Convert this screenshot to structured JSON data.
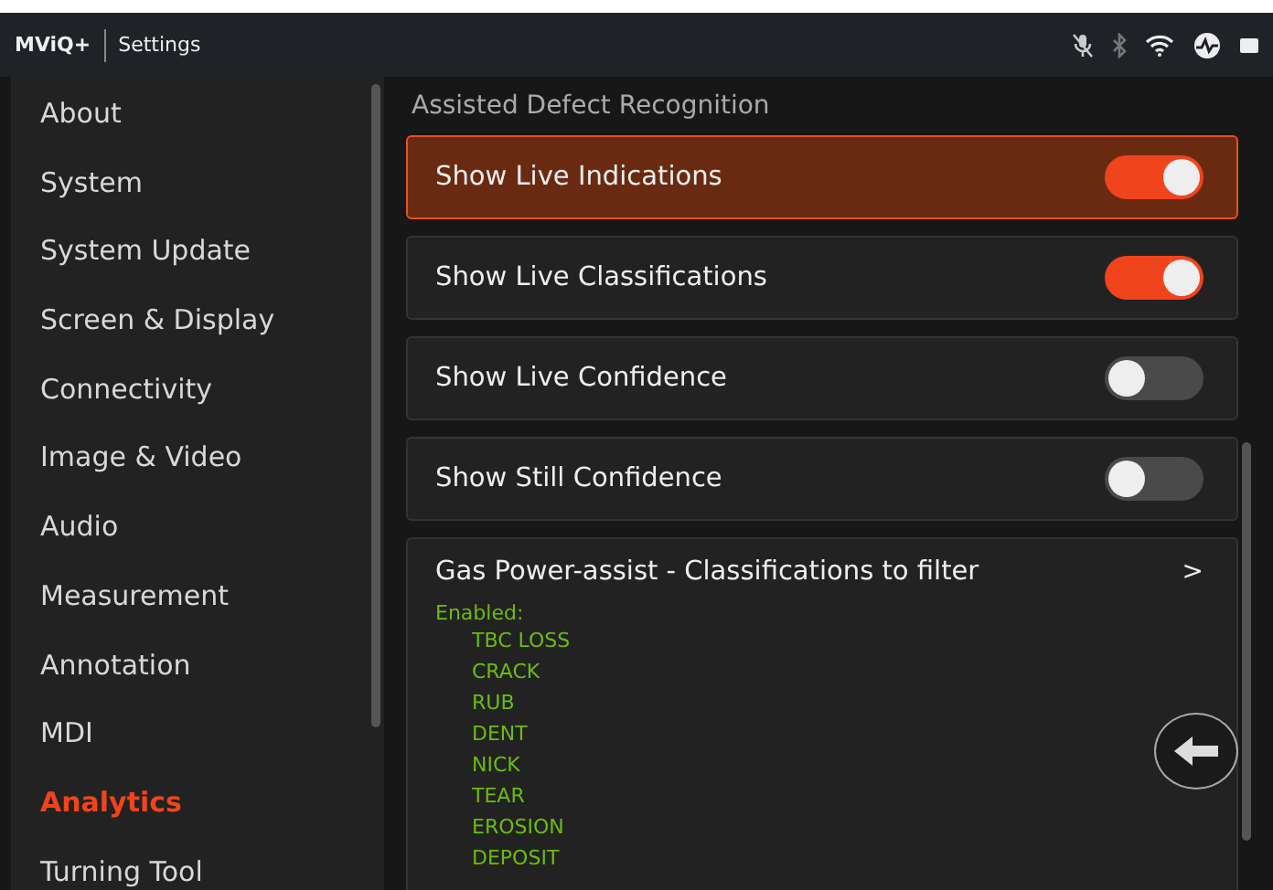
{
  "header": {
    "brand": "MViQ+",
    "title": "Settings"
  },
  "sidebar": {
    "items": [
      {
        "label": "About",
        "selected": false
      },
      {
        "label": "System",
        "selected": false
      },
      {
        "label": "System Update",
        "selected": false
      },
      {
        "label": "Screen & Display",
        "selected": false
      },
      {
        "label": "Connectivity",
        "selected": false
      },
      {
        "label": "Image & Video",
        "selected": false
      },
      {
        "label": "Audio",
        "selected": false
      },
      {
        "label": "Measurement",
        "selected": false
      },
      {
        "label": "Annotation",
        "selected": false
      },
      {
        "label": "MDI",
        "selected": false
      },
      {
        "label": "Analytics",
        "selected": true
      },
      {
        "label": "Turning Tool",
        "selected": false
      }
    ]
  },
  "section_title": "Assisted Defect Recognition",
  "settings": [
    {
      "label": "Show Live Indications",
      "on": true,
      "selected": true
    },
    {
      "label": "Show Live Classifications",
      "on": true,
      "selected": false
    },
    {
      "label": "Show Live Confidence",
      "on": false,
      "selected": false
    },
    {
      "label": "Show Still Confidence",
      "on": false,
      "selected": false
    }
  ],
  "filter": {
    "title": "Gas Power-assist - Classifications to filter",
    "chevron": ">",
    "enabled_label": "Enabled:",
    "items": [
      "TBC LOSS",
      "CRACK",
      "RUB",
      "DENT",
      "NICK",
      "TEAR",
      "EROSION",
      "DEPOSIT"
    ]
  }
}
